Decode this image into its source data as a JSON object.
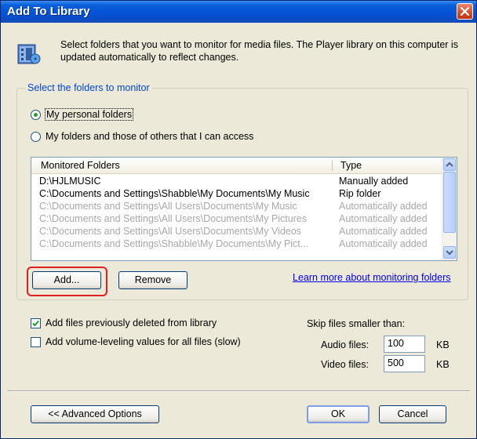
{
  "window": {
    "title": "Add To Library"
  },
  "description": "Select folders that you want to monitor for media files. The Player library on this computer is updated automatically to reflect changes.",
  "folders_group": {
    "legend": "Select the folders to monitor",
    "radio_personal": "My personal folders",
    "radio_personal_selected": true,
    "radio_all": "My folders and those of others that I can access"
  },
  "listview": {
    "columns": [
      "Monitored Folders",
      "Type"
    ],
    "rows": [
      {
        "folder": "D:\\HJLMUSIC",
        "type": "Manually added",
        "dimmed": false
      },
      {
        "folder": "C:\\Documents and Settings\\Shabble\\My Documents\\My Music",
        "type": "Rip folder",
        "dimmed": false
      },
      {
        "folder": "C:\\Documents and Settings\\All Users\\Documents\\My Music",
        "type": "Automatically added",
        "dimmed": true
      },
      {
        "folder": "C:\\Documents and Settings\\All Users\\Documents\\My Pictures",
        "type": "Automatically added",
        "dimmed": true
      },
      {
        "folder": "C:\\Documents and Settings\\All Users\\Documents\\My Videos",
        "type": "Automatically added",
        "dimmed": true
      },
      {
        "folder": "C:\\Documents and Settings\\Shabble\\My Documents\\My Pict...",
        "type": "Automatically added",
        "dimmed": true
      }
    ]
  },
  "buttons": {
    "add": "Add...",
    "remove": "Remove",
    "advanced": "<< Advanced Options",
    "ok": "OK",
    "cancel": "Cancel"
  },
  "link_text": "Learn more about monitoring folders",
  "options": {
    "add_deleted": "Add files previously deleted from library",
    "add_deleted_checked": true,
    "volume_leveling": "Add volume-leveling values for all files (slow)",
    "volume_leveling_checked": false
  },
  "skip": {
    "label": "Skip files smaller than:",
    "audio_label": "Audio files:",
    "audio_value": "100",
    "video_label": "Video files:",
    "video_value": "500",
    "unit": "KB"
  },
  "colors": {
    "title_bar": "#0453d6",
    "highlight": "#e02020",
    "link": "#0000ee",
    "legend": "#0046d5"
  },
  "icons": [
    "library-icon",
    "close-icon",
    "scroll-up-icon",
    "scroll-down-icon",
    "checkmark-icon"
  ]
}
